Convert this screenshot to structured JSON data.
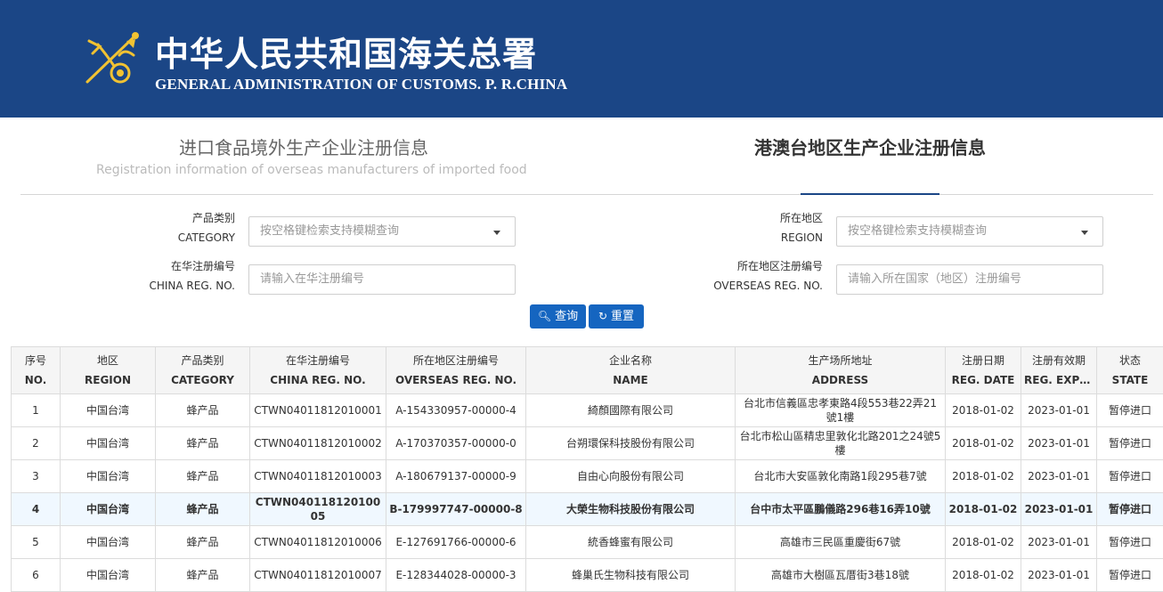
{
  "header": {
    "cn_title": "中华人民共和国海关总署",
    "en_title": "GENERAL ADMINISTRATION OF CUSTOMS. P. R.CHINA",
    "logo_icon": "customs-emblem-icon",
    "brand_color": "#1b4686"
  },
  "tabs": {
    "left_cn": "进口食品境外生产企业注册信息",
    "left_en": "Registration information of overseas manufacturers of imported food",
    "right_cn": "港澳台地区生产企业注册信息"
  },
  "filters": {
    "category": {
      "label_cn": "产品类别",
      "label_en": "CATEGORY",
      "placeholder": "按空格键检索支持模糊查询"
    },
    "region": {
      "label_cn": "所在地区",
      "label_en": "REGION",
      "placeholder": "按空格键检索支持模糊查询"
    },
    "china_reg": {
      "label_cn": "在华注册编号",
      "label_en": "CHINA REG. NO.",
      "placeholder": "请输入在华注册编号"
    },
    "overseas_reg": {
      "label_cn": "所在地区注册编号",
      "label_en": "OVERSEAS REG. NO.",
      "placeholder": "请输入所在国家（地区）注册编号"
    }
  },
  "buttons": {
    "search": "查询",
    "reset": "重置",
    "search_icon": "search-icon",
    "reset_icon": "refresh-icon"
  },
  "table": {
    "headers": [
      {
        "cn": "序号",
        "en": "NO."
      },
      {
        "cn": "地区",
        "en": "REGION"
      },
      {
        "cn": "产品类别",
        "en": "CATEGORY"
      },
      {
        "cn": "在华注册编号",
        "en": "CHINA REG. NO."
      },
      {
        "cn": "所在地区注册编号",
        "en": "OVERSEAS REG. NO."
      },
      {
        "cn": "企业名称",
        "en": "NAME"
      },
      {
        "cn": "生产场所地址",
        "en": "ADDRESS"
      },
      {
        "cn": "注册日期",
        "en": "REG. DATE"
      },
      {
        "cn": "注册有效期",
        "en": "REG. EXPIR..."
      },
      {
        "cn": "状态",
        "en": "STATE"
      }
    ],
    "rows": [
      [
        "1",
        "中国台湾",
        "蜂产品",
        "CTWN04011812010001",
        "A-154330957-00000-4",
        "綺顏國際有限公司",
        "台北市信義區忠孝東路4段553巷22弄21號1樓",
        "2018-01-02",
        "2023-01-01",
        "暂停进口"
      ],
      [
        "2",
        "中国台湾",
        "蜂产品",
        "CTWN04011812010002",
        "A-170370357-00000-0",
        "台朔環保科技股份有限公司",
        "台北市松山區精忠里敦化北路201之24號5樓",
        "2018-01-02",
        "2023-01-01",
        "暂停进口"
      ],
      [
        "3",
        "中国台湾",
        "蜂产品",
        "CTWN04011812010003",
        "A-180679137-00000-9",
        "自由心向股份有限公司",
        "台北市大安區敦化南路1段295巷7號",
        "2018-01-02",
        "2023-01-01",
        "暂停进口"
      ],
      [
        "4",
        "中国台湾",
        "蜂产品",
        "CTWN04011812010005",
        "B-179997747-00000-8",
        "大榮生物科技股份有限公司",
        "台中市太平區鵬儀路296巷16弄10號",
        "2018-01-02",
        "2023-01-01",
        "暂停进口"
      ],
      [
        "5",
        "中国台湾",
        "蜂产品",
        "CTWN04011812010006",
        "E-127691766-00000-6",
        "統香蜂蜜有限公司",
        "高雄市三民區重慶街67號",
        "2018-01-02",
        "2023-01-01",
        "暂停进口"
      ],
      [
        "6",
        "中国台湾",
        "蜂产品",
        "CTWN04011812010007",
        "E-128344028-00000-3",
        "蜂巢氏生物科技有限公司",
        "高雄市大樹區瓦厝街3巷18號",
        "2018-01-02",
        "2023-01-01",
        "暂停进口"
      ]
    ],
    "highlight_row": 3
  }
}
